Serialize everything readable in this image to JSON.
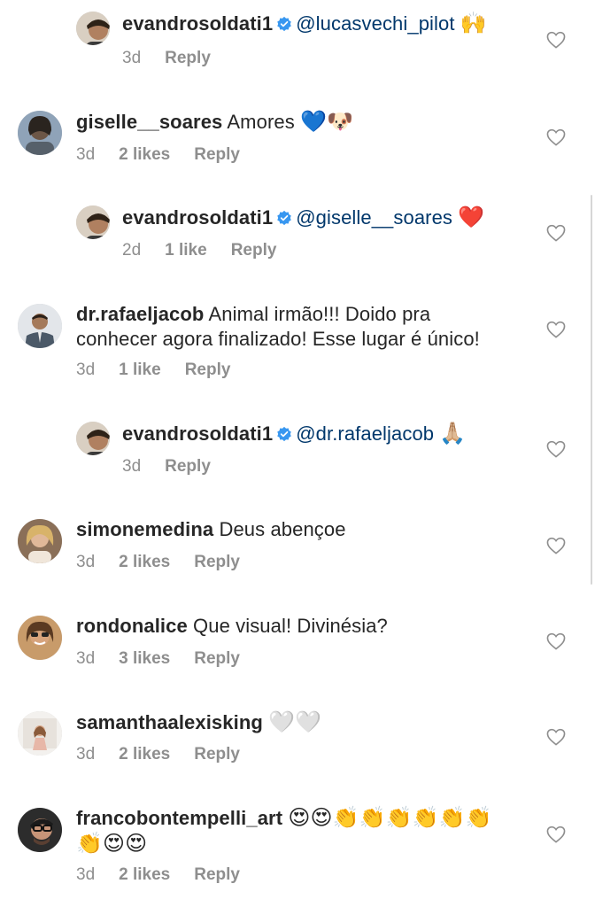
{
  "comments": [
    {
      "username": "evandrosoldati1",
      "verified": true,
      "mention": "@lucasvechi_pilot",
      "text": "",
      "emoji": "🙌",
      "time": "3d",
      "likes": "",
      "reply": "Reply",
      "reply_thread": true
    },
    {
      "username": "giselle__soares",
      "verified": false,
      "mention": "",
      "text": "Amores",
      "emoji": "💙🐶",
      "time": "3d",
      "likes": "2 likes",
      "reply": "Reply",
      "reply_thread": false
    },
    {
      "username": "evandrosoldati1",
      "verified": true,
      "mention": "@giselle__soares",
      "text": "",
      "emoji": "❤️",
      "time": "2d",
      "likes": "1 like",
      "reply": "Reply",
      "reply_thread": true
    },
    {
      "username": "dr.rafaeljacob",
      "verified": false,
      "mention": "",
      "text": "Animal irmão!!! Doido pra conhecer agora finalizado! Esse lugar é único!",
      "emoji": "",
      "time": "3d",
      "likes": "1 like",
      "reply": "Reply",
      "reply_thread": false
    },
    {
      "username": "evandrosoldati1",
      "verified": true,
      "mention": "@dr.rafaeljacob",
      "text": "",
      "emoji": "🙏🏼",
      "time": "3d",
      "likes": "",
      "reply": "Reply",
      "reply_thread": true
    },
    {
      "username": "simonemedina",
      "verified": false,
      "mention": "",
      "text": "Deus abençoe",
      "emoji": "",
      "time": "3d",
      "likes": "2 likes",
      "reply": "Reply",
      "reply_thread": false
    },
    {
      "username": "rondonalice",
      "verified": false,
      "mention": "",
      "text": "Que visual! Divinésia?",
      "emoji": "",
      "time": "3d",
      "likes": "3 likes",
      "reply": "Reply",
      "reply_thread": false
    },
    {
      "username": "samanthaalexisking",
      "verified": false,
      "mention": "",
      "text": "",
      "emoji": "🤍🤍",
      "time": "3d",
      "likes": "2 likes",
      "reply": "Reply",
      "reply_thread": false
    },
    {
      "username": "francobontempelli_art",
      "verified": false,
      "mention": "",
      "text": "",
      "emoji": "😍😍👏👏👏👏👏👏👏😍😍",
      "time": "3d",
      "likes": "2 likes",
      "reply": "Reply",
      "reply_thread": false
    }
  ],
  "icons": {
    "like": "heart-outline-icon",
    "verified": "verified-badge-icon"
  },
  "colors": {
    "username": "#262626",
    "meta": "#8e8e8e",
    "mention": "#00376b",
    "verified": "#3897f0"
  }
}
